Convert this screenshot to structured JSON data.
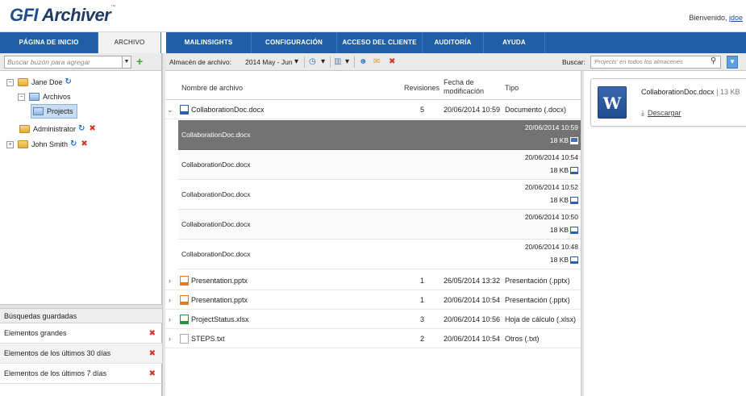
{
  "header": {
    "logo_brand": "GFI",
    "logo_product": "Archiver",
    "logo_tm": "™",
    "welcome_text": "Bienvenido,",
    "user": "jdoe"
  },
  "nav": {
    "tabs": [
      {
        "label": "Página de inicio"
      },
      {
        "label": "Archivo"
      },
      {
        "label": "MailInsights"
      },
      {
        "label": "Configuración"
      },
      {
        "label": "Acceso del cliente"
      },
      {
        "label": "Auditoría"
      },
      {
        "label": "Ayuda"
      }
    ]
  },
  "left": {
    "search_placeholder": "Buscar buzón para agregar",
    "tree": {
      "jane": "Jane Doe",
      "archivos": "Archivos",
      "projects": "Projects",
      "administrator": "Administrator",
      "john": "John Smith"
    },
    "saved_header": "Búsquedas guardadas",
    "saved": [
      {
        "label": "Elementos grandes"
      },
      {
        "label": "Elementos de los últimos 30 días"
      },
      {
        "label": "Elementos de los últimos 7 días"
      }
    ]
  },
  "toolbar": {
    "store_label": "Almacén de archivo:",
    "store_value": "2014 May - Jun",
    "search_label": "Buscar:",
    "search_placeholder": "'Projects' en todos los almacenes"
  },
  "grid": {
    "columns": {
      "name": "Nombre de archivo",
      "revisions": "Revisiones",
      "modified": "Fecha de modificación",
      "type": "Tipo"
    },
    "rows": [
      {
        "name": "CollaborationDoc.docx",
        "revisions": "5",
        "modified": "20/06/2014 10:59",
        "type": "Documento (.docx)"
      },
      {
        "name": "Presentation.pptx",
        "revisions": "1",
        "modified": "26/05/2014 13:32",
        "type": "Presentación (.pptx)"
      },
      {
        "name": "Presentation.pptx",
        "revisions": "1",
        "modified": "20/06/2014 10:54",
        "type": "Presentación (.pptx)"
      },
      {
        "name": "ProjectStatus.xlsx",
        "revisions": "3",
        "modified": "20/06/2014 10:56",
        "type": "Hoja de cálculo (.xlsx)"
      },
      {
        "name": "STEPS.txt",
        "revisions": "2",
        "modified": "20/06/2014 10:54",
        "type": "Otros (.txt)"
      }
    ],
    "versions": [
      {
        "name": "CollaborationDoc.docx",
        "date": "20/06/2014 10:59",
        "size": "18 KB"
      },
      {
        "name": "CollaborationDoc.docx",
        "date": "20/06/2014 10:54",
        "size": "18 KB"
      },
      {
        "name": "CollaborationDoc.docx",
        "date": "20/06/2014 10:52",
        "size": "18 KB"
      },
      {
        "name": "CollaborationDoc.docx",
        "date": "20/06/2014 10:50",
        "size": "18 KB"
      },
      {
        "name": "CollaborationDoc.docx",
        "date": "20/06/2014 10:48",
        "size": "18 KB"
      }
    ]
  },
  "preview": {
    "filename": "CollaborationDoc.docx",
    "sep": "|",
    "size": "13 KB",
    "download": "Descargar"
  }
}
